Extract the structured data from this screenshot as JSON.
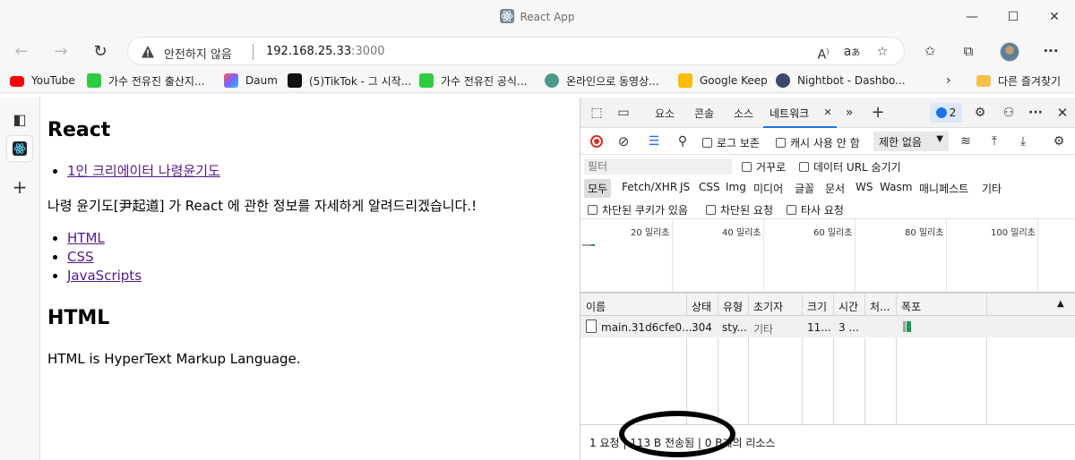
{
  "window": {
    "title": "React App"
  },
  "address": {
    "security_text": "안전하지 않음",
    "host": "192.168.25.33",
    "port": ":3000"
  },
  "bookmarks": [
    {
      "label": "YouTube",
      "color": "#ff0000"
    },
    {
      "label": "가수 전유진 출산지...",
      "color": "#2ecc40"
    },
    {
      "label": "Daum",
      "color": "#7b61ff"
    },
    {
      "label": "(5)TikTok - 그 시작...",
      "color": "#111111"
    },
    {
      "label": "가수 전유진 공식...",
      "color": "#2ecc40"
    },
    {
      "label": "온라인으로 동영상...",
      "color": "#4a9a8a"
    },
    {
      "label": "Google Keep",
      "color": "#fbbc04"
    },
    {
      "label": "Nightbot - Dashbo...",
      "color": "#3b4a6b"
    }
  ],
  "bookmarks_folder": "다른 즐겨찾기",
  "page": {
    "heading1": "React",
    "link1": "1인 크리에이터 나령윤기도",
    "paragraph1": "나령 윤기도[尹起道] 가 React 에 관한 정보를 자세하게 알려드리겠습니다.!",
    "links": [
      "HTML",
      "CSS",
      "JavaScripts"
    ],
    "heading2": "HTML",
    "paragraph2": "HTML is HyperText Markup Language."
  },
  "devtools": {
    "tabs": [
      "요소",
      "콘솔",
      "소스",
      "네트워크"
    ],
    "active_tab": "네트워크",
    "issues_count": "2",
    "toolbar": {
      "disable_log": "로그 보존",
      "disable_cache": "캐시 사용 안 함",
      "throttle": "제한 없음"
    },
    "filter": {
      "placeholder": "필터",
      "invert": "거꾸로",
      "hide_data_urls": "데이터 URL 숨기기",
      "types": [
        "모두",
        "Fetch/XHR",
        "JS",
        "CSS",
        "Img",
        "미디어",
        "글꼴",
        "문서",
        "WS",
        "Wasm",
        "매니페스트",
        "기타"
      ],
      "blocked_cookies": "차단된 쿠키가 있음",
      "blocked_requests": "차단된 요청",
      "third_party": "타사 요청"
    },
    "timeline_labels": [
      "20 밀리초",
      "40 밀리초",
      "60 밀리초",
      "80 밀리초",
      "100 밀리초"
    ],
    "columns": [
      "이름",
      "상태",
      "유형",
      "초기자",
      "크기",
      "시간",
      "처...",
      "폭포"
    ],
    "rows": [
      {
        "name": "main.31d6cfe0....",
        "status": "304",
        "type": "sty...",
        "initiator": "기타",
        "size": "11...",
        "time": "3 ..."
      }
    ],
    "status_bar": {
      "requests": "1 요청",
      "transferred": "113 B 전송됨",
      "resources": "0 B개의 리소스"
    }
  }
}
